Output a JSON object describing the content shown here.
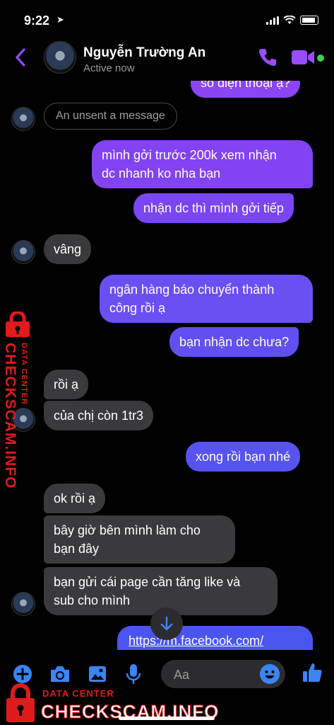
{
  "status_bar": {
    "time": "9:22"
  },
  "header": {
    "contact_name": "Nguyễn Trường An",
    "contact_status": "Active now"
  },
  "messages": {
    "top_partial": "số điện thoại ạ?",
    "unsent": "An unsent a message",
    "m1": "mình gởi trước 200k xem nhận",
    "m1b": "dc nhanh ko nha bạn",
    "m2": "nhận dc thì mình gởi tiếp",
    "m3": "vâng",
    "m4": "ngân hàng báo chuyển thành",
    "m4b": "công rồi ạ",
    "m5": "bạn nhận dc chưa?",
    "m6": "rồi ạ",
    "m7": "của chị còn 1tr3",
    "m8": "xong rồi bạn nhé",
    "m9": "ok rồi ạ",
    "m10": "bây giờ bên mình làm cho",
    "m10b": "bạn đây",
    "m11": "bạn gửi cái page cần tăng like và",
    "m11b": "sub cho mình",
    "m12": "https://m.facebook.com/"
  },
  "compose": {
    "placeholder": "Aa"
  },
  "watermark": {
    "side_label": "DATA CENTER",
    "side_brand": "CHECKSCAM.INFO",
    "bottom_label": "DATA CENTER",
    "bottom_brand": "CHECKSCAM.INFO"
  },
  "colors": {
    "accent": "#8a4dff",
    "bubble_out_top": "#8a45f5",
    "bubble_out_bottom": "#4a55f0",
    "bubble_in": "#3a3a3c",
    "watermark": "#e01b1b"
  },
  "icons": [
    "back-icon",
    "phone-icon",
    "video-icon",
    "plus-icon",
    "camera-icon",
    "image-icon",
    "mic-icon",
    "emoji-icon",
    "like-icon",
    "arrow-down-icon",
    "lock-icon"
  ]
}
